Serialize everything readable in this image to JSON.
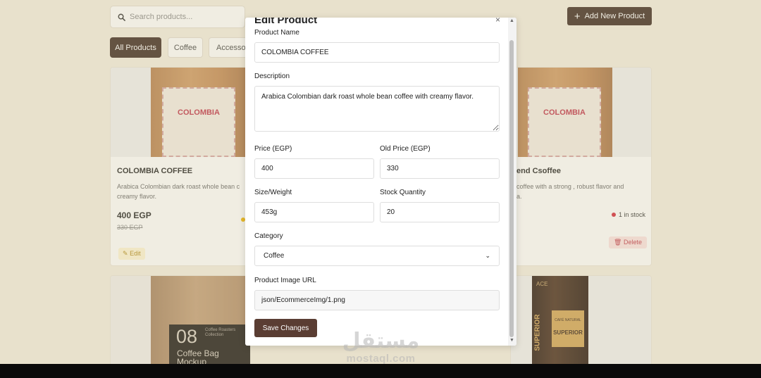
{
  "search": {
    "placeholder": "Search products..."
  },
  "toolbar": {
    "add_label": "Add New Product"
  },
  "filters": [
    {
      "label": "All Products"
    },
    {
      "label": "Coffee"
    },
    {
      "label": "Accessor"
    }
  ],
  "cards": [
    {
      "label_text": "COLOMBIA",
      "title": "COLOMBIA COFFEE",
      "desc_line1": "Arabica Colombian dark roast whole bean c",
      "desc_line2": "creamy flavor.",
      "price": "400 EGP",
      "old_price": "330 EGP",
      "edit_label": "Edit"
    },
    {
      "label_text": "COLOMBIA",
      "title": "end Csoffee",
      "desc_line1": "coffee with a strong , robust flavor and",
      "desc_line2": "a.",
      "stock": "1 in stock",
      "delete_label": "Delete"
    },
    {
      "bag_number": "08",
      "bag_text1": "Coffee Bag",
      "bag_text2": "Mockup",
      "bag_small": "Coffee Roasters Collection"
    },
    {
      "bag_brand": "ACE",
      "bag_side": "SUPERIOR",
      "bag_natural": "CAFÉ NATURAL",
      "bag_superior": "SUPERIOR"
    }
  ],
  "modal": {
    "title": "Edit Product",
    "close": "×",
    "fields": {
      "name_label": "Product Name",
      "name_value": "COLOMBIA COFFEE",
      "desc_label": "Description",
      "desc_value": "Arabica Colombian dark roast whole bean coffee with creamy flavor.",
      "price_label": "Price (EGP)",
      "price_value": "400",
      "old_price_label": "Old Price (EGP)",
      "old_price_value": "330",
      "size_label": "Size/Weight",
      "size_value": "453g",
      "stock_label": "Stock Quantity",
      "stock_value": "20",
      "category_label": "Category",
      "category_value": "Coffee",
      "image_label": "Product Image URL",
      "image_value": "json/EcommerceImg/1.png"
    },
    "save_label": "Save Changes"
  },
  "watermark": {
    "arabic": "مستقل",
    "latin": "mostaql.com"
  },
  "colors": {
    "accent": "#3e2a22",
    "save": "#5a3d33",
    "background": "#f4efe1",
    "danger": "#d4283b"
  }
}
